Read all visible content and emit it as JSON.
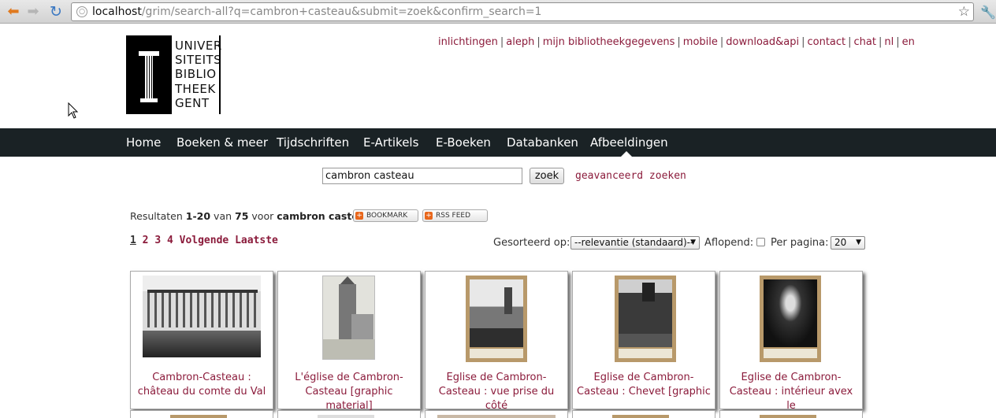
{
  "browser": {
    "url_host": "localhost",
    "url_path": "/grim/search-all?q=cambron+casteau&submit=zoek&confirm_search=1"
  },
  "logo": {
    "lines": [
      "UNIVER",
      "SITEITS",
      "BIBLIO",
      "THEEK",
      "GENT"
    ]
  },
  "top_links": [
    "inlichtingen",
    "aleph",
    "mijn bibliotheekgegevens",
    "mobile",
    "download&api",
    "contact",
    "chat",
    "nl",
    "en"
  ],
  "nav": {
    "items": [
      "Home",
      "Boeken & meer",
      "Tijdschriften",
      "E-Artikels",
      "E-Boeken",
      "Databanken",
      "Afbeeldingen"
    ],
    "active": "Afbeeldingen"
  },
  "search": {
    "query": "cambron casteau",
    "button": "zoek",
    "advanced": "geavanceerd zoeken"
  },
  "results": {
    "label": "Resultaten",
    "range": "1-20",
    "of_word": "van",
    "total": "75",
    "for_word": "voor",
    "query": "cambron casteau",
    "bookmark": "BOOKMARK",
    "rss": "RSS FEED"
  },
  "pager": {
    "current": "1",
    "pages": [
      "2",
      "3",
      "4"
    ],
    "next": "Volgende",
    "last": "Laatste"
  },
  "controls": {
    "sort_label": "Gesorteerd op:",
    "sort_value": "--relevantie (standaard)--",
    "descending_label": "Aflopend:",
    "descending_checked": false,
    "perpage_label": "Per pagina:",
    "perpage_value": "20"
  },
  "items": [
    {
      "line1": "Cambron-Casteau :",
      "line2": "château du comte du Val"
    },
    {
      "line1": "L'église de Cambron-",
      "line2": "Casteau [graphic material]"
    },
    {
      "line1": "Eglise de Cambron-",
      "line2": "Casteau : vue prise du côté"
    },
    {
      "line1": "Eglise de Cambron-",
      "line2": "Casteau : Chevet [graphic"
    },
    {
      "line1": "Eglise de Cambron-",
      "line2": "Casteau : intérieur avex le"
    }
  ]
}
